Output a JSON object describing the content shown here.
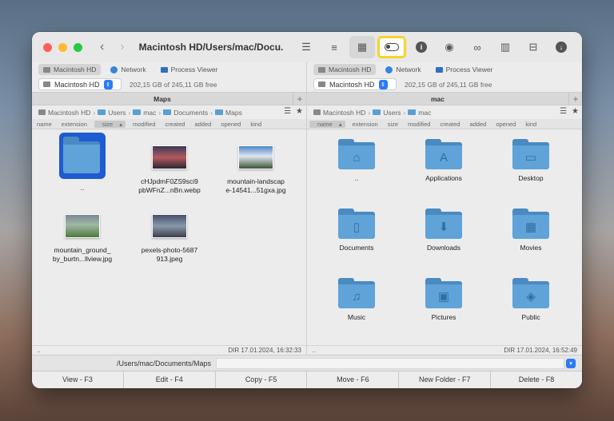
{
  "window": {
    "title": "Macintosh HD/Users/mac/Docu..."
  },
  "toolbar": {
    "icons": [
      "list-icon",
      "detail-list-icon",
      "grid-icon",
      "toggle-icon",
      "info-icon",
      "eye-icon",
      "binoculars-icon",
      "archive-icon",
      "network-drive-icon",
      "download-icon"
    ]
  },
  "left": {
    "tabs": [
      {
        "label": "Macintosh HD",
        "active": true
      },
      {
        "label": "Network"
      },
      {
        "label": "Process Viewer"
      }
    ],
    "drive": {
      "name": "Macintosh HD",
      "free": "202,15 GB of 245,11 GB free"
    },
    "title": "Maps",
    "plus": "+",
    "breadcrumb": [
      "Macintosh HD",
      "Users",
      "mac",
      "Documents",
      "Maps"
    ],
    "columns": [
      "name",
      "extension",
      "size",
      "modified",
      "created",
      "added",
      "opened",
      "kind"
    ],
    "sorted_column": "size",
    "items": [
      {
        "label": "..",
        "type": "folder-selected"
      },
      {
        "label": "cHJpdmF0ZS9sci9\npbWFnZ...nBn.webp",
        "type": "image"
      },
      {
        "label": "mountain-landscap\ne-14541...51gxa.jpg",
        "type": "image"
      },
      {
        "label": "mountain_ground_\nby_burtn...llview.jpg",
        "type": "image"
      },
      {
        "label": "pexels-photo-5687\n913.jpeg",
        "type": "image"
      }
    ],
    "status_left": "..",
    "status_right": "DIR  17.01.2024, 16:32:33"
  },
  "right": {
    "tabs": [
      {
        "label": "Macintosh HD",
        "active": true
      },
      {
        "label": "Network"
      },
      {
        "label": "Process Viewer"
      }
    ],
    "drive": {
      "name": "Macintosh HD",
      "free": "202,15 GB of 245,11 GB free"
    },
    "title": "mac",
    "plus": "+",
    "breadcrumb": [
      "Macintosh HD",
      "Users",
      "mac"
    ],
    "columns": [
      "name",
      "extension",
      "size",
      "modified",
      "created",
      "added",
      "opened",
      "kind"
    ],
    "sorted_column": "name",
    "items": [
      {
        "label": "..",
        "glyph": "⌂"
      },
      {
        "label": "Applications",
        "glyph": "A"
      },
      {
        "label": "Desktop",
        "glyph": "▭"
      },
      {
        "label": "Documents",
        "glyph": "▯"
      },
      {
        "label": "Downloads",
        "glyph": "⬇"
      },
      {
        "label": "Movies",
        "glyph": "▦"
      },
      {
        "label": "Music",
        "glyph": "♫"
      },
      {
        "label": "Pictures",
        "glyph": "▣"
      },
      {
        "label": "Public",
        "glyph": "◈"
      }
    ],
    "status_left": "..",
    "status_right": "DIR  17.01.2024, 16:52:49"
  },
  "command_line": {
    "path": "/Users/mac/Documents/Maps"
  },
  "function_keys": [
    "View - F3",
    "Edit - F4",
    "Copy - F5",
    "Move - F6",
    "New Folder - F7",
    "Delete - F8"
  ]
}
